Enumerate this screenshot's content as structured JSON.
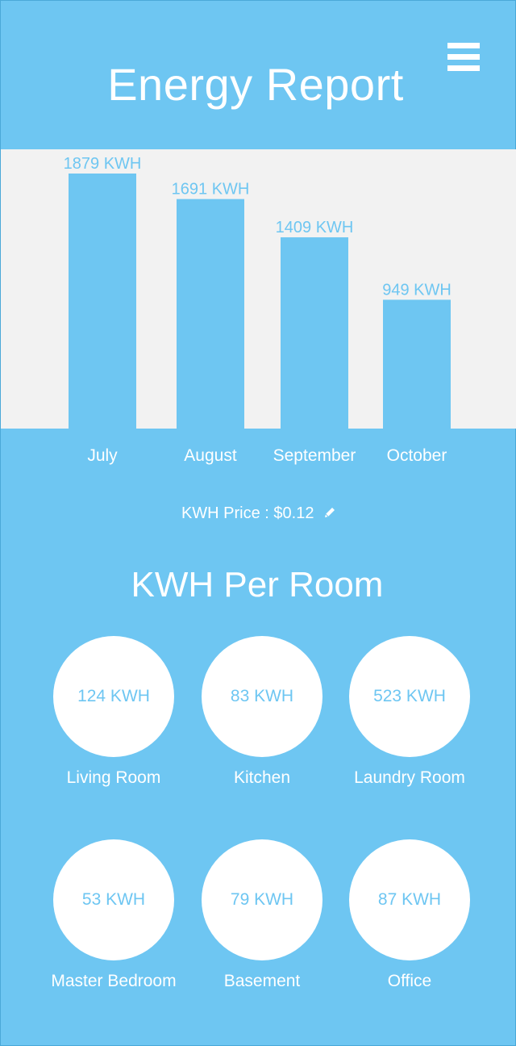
{
  "header": {
    "title": "Energy Report",
    "menu_icon": "hamburger-menu-icon"
  },
  "chart_data": {
    "type": "bar",
    "categories": [
      "July",
      "August",
      "September",
      "October"
    ],
    "values": [
      1879,
      1691,
      1409,
      949
    ],
    "data_labels": [
      "1879 KWH",
      "1691 KWH",
      "1409 KWH",
      "949 KWH"
    ],
    "unit": "KWH",
    "title": "",
    "xlabel": "",
    "ylabel": "",
    "grid": false
  },
  "price": {
    "label": "KWH Price : $0.12",
    "edit_icon": "pencil-icon"
  },
  "rooms": {
    "title": "KWH Per Room",
    "items": [
      {
        "name": "Living Room",
        "value": "124 KWH"
      },
      {
        "name": "Kitchen",
        "value": "83 KWH"
      },
      {
        "name": "Laundry Room",
        "value": "523 KWH"
      },
      {
        "name": "Master Bedroom",
        "value": "53 KWH"
      },
      {
        "name": "Basement",
        "value": "79 KWH"
      },
      {
        "name": "Office",
        "value": "87 KWH"
      }
    ]
  },
  "colors": {
    "background": "#6ec6f2",
    "chart_panel": "#f2f2f2",
    "bars": "#6ec6f2",
    "text": "#ffffff"
  }
}
